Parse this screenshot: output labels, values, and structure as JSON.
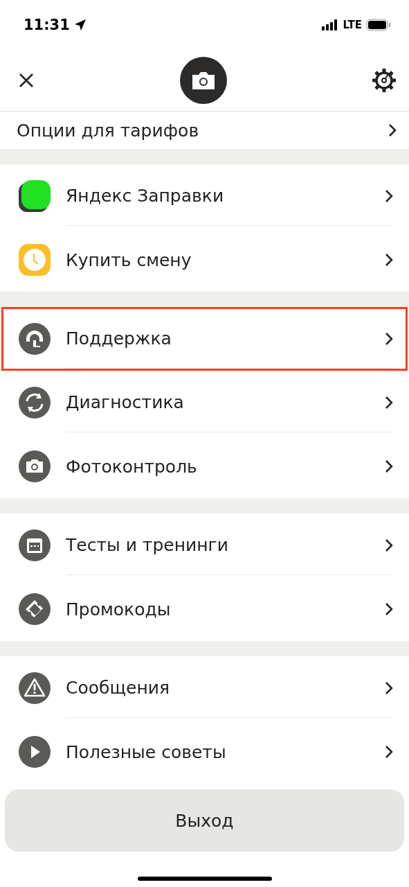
{
  "status_bar": {
    "time": "11:31",
    "network": "LTE"
  },
  "partial_row": {
    "label": "Опции для тарифов"
  },
  "groups": [
    {
      "items": [
        {
          "label": "Яндекс Заправки",
          "highlighted": false
        },
        {
          "label": "Купить смену",
          "highlighted": false
        }
      ]
    },
    {
      "items": [
        {
          "label": "Поддержка",
          "highlighted": true
        },
        {
          "label": "Диагностика",
          "highlighted": false
        },
        {
          "label": "Фотоконтроль",
          "highlighted": false
        }
      ]
    },
    {
      "items": [
        {
          "label": "Тесты и тренинги",
          "highlighted": false
        },
        {
          "label": "Промокоды",
          "highlighted": false
        }
      ]
    },
    {
      "items": [
        {
          "label": "Сообщения",
          "highlighted": false
        },
        {
          "label": "Полезные советы",
          "highlighted": false
        }
      ]
    }
  ],
  "logout_button": "Выход"
}
